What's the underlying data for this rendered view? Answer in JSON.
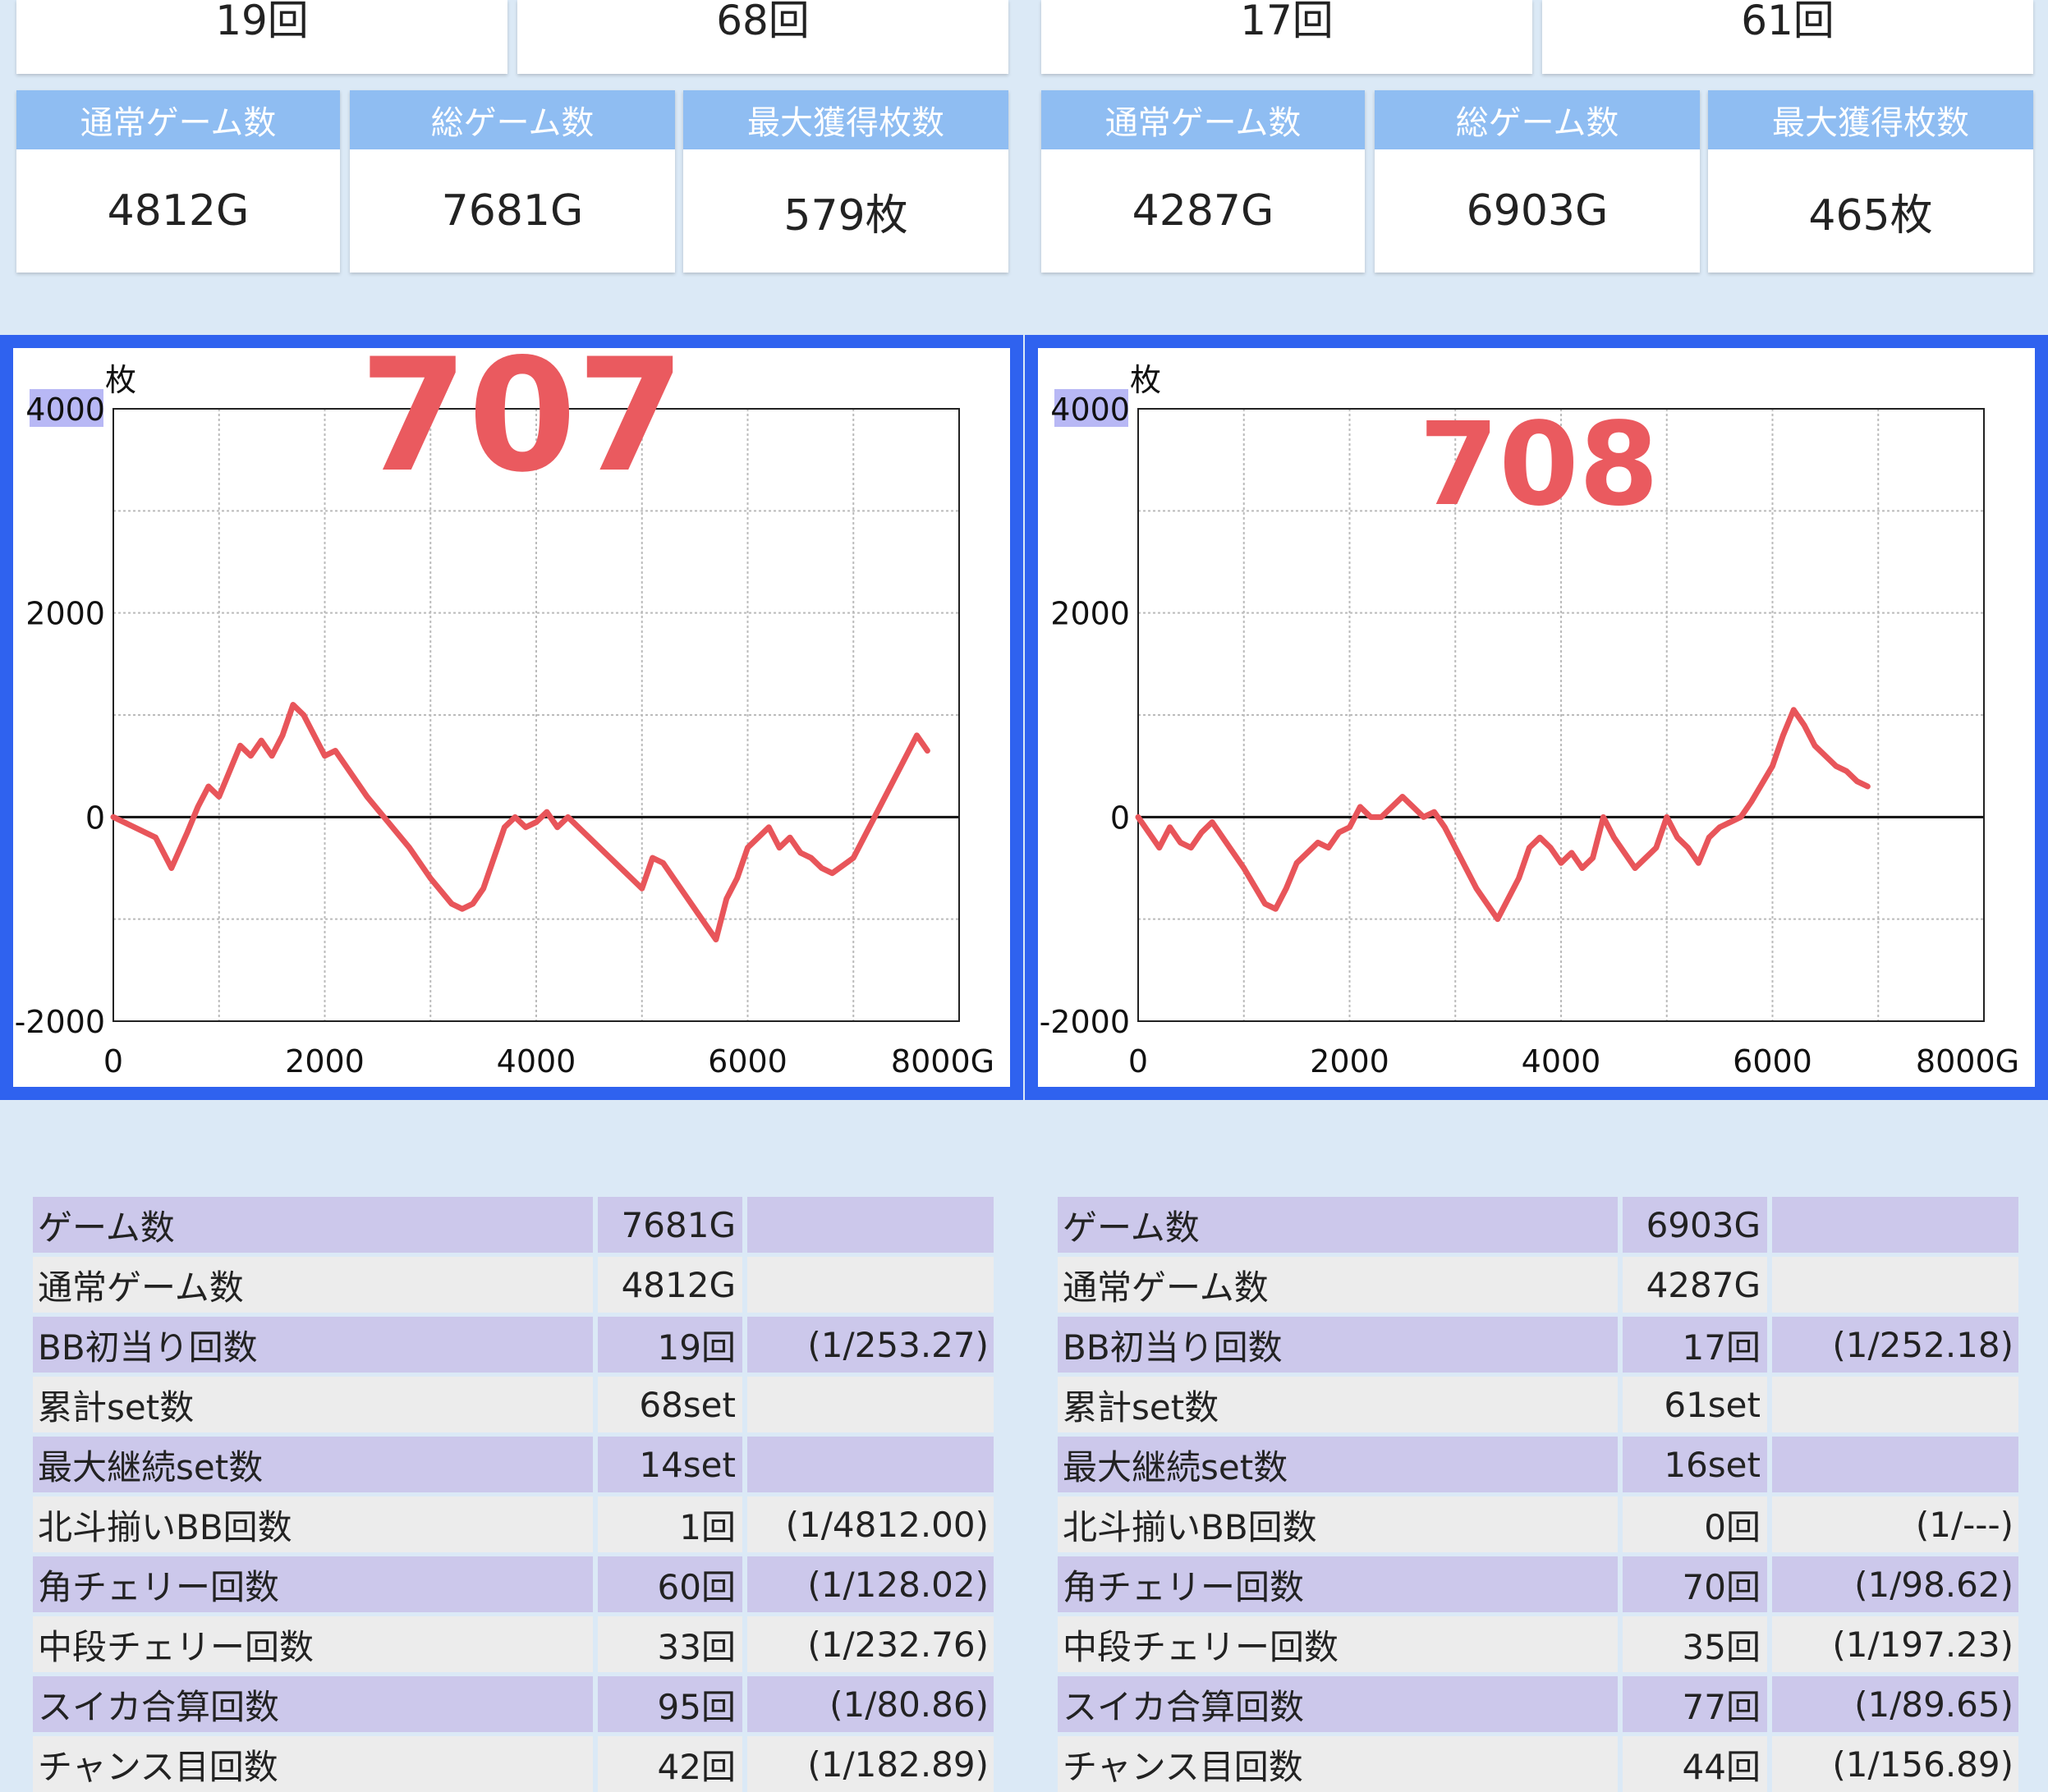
{
  "left": {
    "counts": [
      "19回",
      "68回"
    ],
    "stats": [
      {
        "label": "通常ゲーム数",
        "value": "4812G"
      },
      {
        "label": "総ゲーム数",
        "value": "7681G"
      },
      {
        "label": "最大獲得枚数",
        "value": "579枚"
      }
    ],
    "overlay_number": "707",
    "chart_data": {
      "type": "line",
      "title": "",
      "xlabel": "",
      "ylabel": "枚",
      "x_unit": "G",
      "xlim": [
        0,
        8000
      ],
      "ylim": [
        -2000,
        4000
      ],
      "x_ticks": [
        "0",
        "2000",
        "4000",
        "6000",
        "8000G"
      ],
      "y_ticks": [
        "4000",
        "2000",
        "0",
        "-2000"
      ],
      "grid": true,
      "series": [
        {
          "color": "#e8555a",
          "x": [
            0,
            200,
            400,
            550,
            700,
            800,
            900,
            1000,
            1100,
            1200,
            1300,
            1400,
            1500,
            1600,
            1700,
            1800,
            1900,
            2000,
            2100,
            2200,
            2400,
            2600,
            2800,
            3000,
            3200,
            3300,
            3400,
            3500,
            3600,
            3700,
            3800,
            3900,
            4000,
            4100,
            4200,
            4300,
            4400,
            4600,
            4800,
            5000,
            5100,
            5200,
            5300,
            5500,
            5700,
            5800,
            5900,
            6000,
            6100,
            6200,
            6300,
            6400,
            6500,
            6600,
            6700,
            6800,
            7000,
            7200,
            7400,
            7500,
            7600,
            7700
          ],
          "y": [
            0,
            -100,
            -200,
            -500,
            -150,
            100,
            300,
            200,
            450,
            700,
            600,
            750,
            600,
            800,
            1100,
            1000,
            800,
            600,
            650,
            500,
            200,
            -50,
            -300,
            -600,
            -850,
            -900,
            -850,
            -700,
            -400,
            -100,
            0,
            -100,
            -50,
            50,
            -100,
            0,
            -100,
            -300,
            -500,
            -700,
            -400,
            -450,
            -600,
            -900,
            -1200,
            -800,
            -600,
            -300,
            -200,
            -100,
            -300,
            -200,
            -350,
            -400,
            -500,
            -550,
            -400,
            0,
            400,
            600,
            800,
            650
          ]
        }
      ]
    },
    "table": [
      {
        "label": "ゲーム数",
        "value": "7681G",
        "ratio": ""
      },
      {
        "label": "通常ゲーム数",
        "value": "4812G",
        "ratio": ""
      },
      {
        "label": "BB初当り回数",
        "value": "19回",
        "ratio": "(1/253.27)"
      },
      {
        "label": "累計set数",
        "value": "68set",
        "ratio": ""
      },
      {
        "label": "最大継続set数",
        "value": "14set",
        "ratio": ""
      },
      {
        "label": "北斗揃いBB回数",
        "value": "1回",
        "ratio": "(1/4812.00)"
      },
      {
        "label": "角チェリー回数",
        "value": "60回",
        "ratio": "(1/128.02)"
      },
      {
        "label": "中段チェリー回数",
        "value": "33回",
        "ratio": "(1/232.76)"
      },
      {
        "label": "スイカ合算回数",
        "value": "95回",
        "ratio": "(1/80.86)"
      },
      {
        "label": "チャンス目回数",
        "value": "42回",
        "ratio": "(1/182.89)"
      }
    ]
  },
  "right": {
    "counts": [
      "17回",
      "61回"
    ],
    "stats": [
      {
        "label": "通常ゲーム数",
        "value": "4287G"
      },
      {
        "label": "総ゲーム数",
        "value": "6903G"
      },
      {
        "label": "最大獲得枚数",
        "value": "465枚"
      }
    ],
    "overlay_number": "708",
    "chart_data": {
      "type": "line",
      "title": "",
      "xlabel": "",
      "ylabel": "枚",
      "x_unit": "G",
      "xlim": [
        0,
        8000
      ],
      "ylim": [
        -2000,
        4000
      ],
      "x_ticks": [
        "0",
        "2000",
        "4000",
        "6000",
        "8000G"
      ],
      "y_ticks": [
        "4000",
        "2000",
        "0",
        "-2000"
      ],
      "grid": true,
      "series": [
        {
          "color": "#e8555a",
          "x": [
            0,
            100,
            200,
            300,
            400,
            500,
            600,
            700,
            800,
            1000,
            1200,
            1300,
            1400,
            1500,
            1600,
            1700,
            1800,
            1900,
            2000,
            2100,
            2200,
            2300,
            2500,
            2600,
            2700,
            2800,
            2900,
            3000,
            3200,
            3400,
            3600,
            3700,
            3800,
            3900,
            4000,
            4100,
            4200,
            4300,
            4400,
            4500,
            4600,
            4700,
            4800,
            4900,
            5000,
            5100,
            5200,
            5300,
            5400,
            5500,
            5600,
            5700,
            5800,
            6000,
            6100,
            6200,
            6300,
            6400,
            6500,
            6600,
            6700,
            6800,
            6900
          ],
          "y": [
            0,
            -150,
            -300,
            -100,
            -250,
            -300,
            -150,
            -50,
            -200,
            -500,
            -850,
            -900,
            -700,
            -450,
            -350,
            -250,
            -300,
            -150,
            -100,
            100,
            0,
            0,
            200,
            100,
            0,
            50,
            -100,
            -300,
            -700,
            -1000,
            -600,
            -300,
            -200,
            -300,
            -450,
            -350,
            -500,
            -400,
            0,
            -200,
            -350,
            -500,
            -400,
            -300,
            0,
            -200,
            -300,
            -450,
            -200,
            -100,
            -50,
            0,
            150,
            500,
            800,
            1050,
            900,
            700,
            600,
            500,
            450,
            350,
            300
          ]
        }
      ]
    },
    "table": [
      {
        "label": "ゲーム数",
        "value": "6903G",
        "ratio": ""
      },
      {
        "label": "通常ゲーム数",
        "value": "4287G",
        "ratio": ""
      },
      {
        "label": "BB初当り回数",
        "value": "17回",
        "ratio": "(1/252.18)"
      },
      {
        "label": "累計set数",
        "value": "61set",
        "ratio": ""
      },
      {
        "label": "最大継続set数",
        "value": "16set",
        "ratio": ""
      },
      {
        "label": "北斗揃いBB回数",
        "value": "0回",
        "ratio": "(1/---)"
      },
      {
        "label": "角チェリー回数",
        "value": "70回",
        "ratio": "(1/98.62)"
      },
      {
        "label": "中段チェリー回数",
        "value": "35回",
        "ratio": "(1/197.23)"
      },
      {
        "label": "スイカ合算回数",
        "value": "77回",
        "ratio": "(1/89.65)"
      },
      {
        "label": "チャンス目回数",
        "value": "44回",
        "ratio": "(1/156.89)"
      }
    ]
  }
}
